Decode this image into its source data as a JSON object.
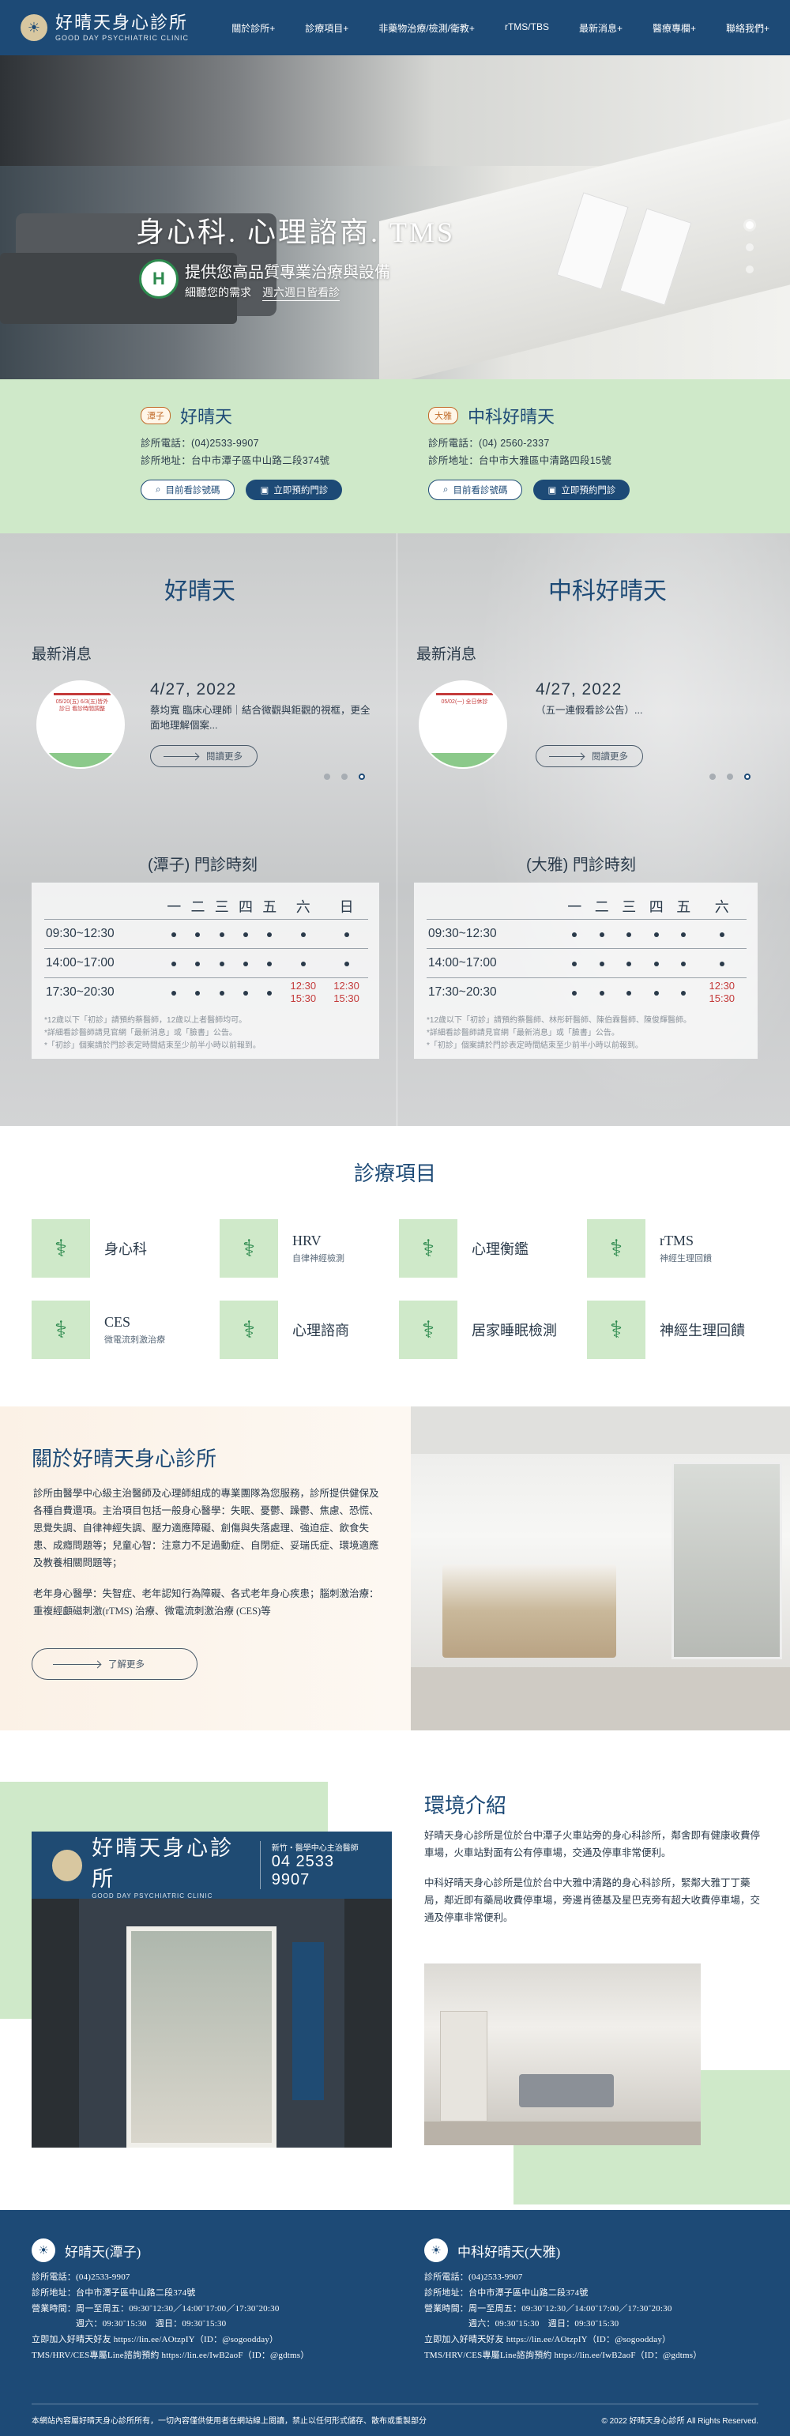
{
  "header": {
    "logo_title": "好晴天身心診所",
    "logo_sub": "GOOD DAY PSYCHIATRIC CLINIC",
    "nav": [
      "關於診所+",
      "診療項目+",
      "非藥物治療/檢測/衛教+",
      "rTMS/TBS",
      "最新消息+",
      "醫療專欄+",
      "聯絡我們+"
    ]
  },
  "hero": {
    "title": "身心科. 心理諮商. TMS",
    "badge": "H",
    "subtitle": "提供您高品質專業治療與設備",
    "sub2_a": "細聽您的需求",
    "sub2_b": "週六週日皆看診"
  },
  "branches": [
    {
      "tag": "潭子",
      "name": "好晴天",
      "phone": "診所電話：(04)2533-9907",
      "address": "診所地址：台中市潭子區中山路二段374號",
      "btn1": "目前看診號碼",
      "btn2": "立即預約門診"
    },
    {
      "tag": "大雅",
      "name": "中科好晴天",
      "phone": "診所電話：(04) 2560-2337",
      "address": "診所地址：台中市大雅區中清路四段15號",
      "btn1": "目前看診號碼",
      "btn2": "立即預約門診"
    }
  ],
  "news": [
    {
      "col_title": "好晴天",
      "heading": "最新消息",
      "poster": "05/20(五) 6/3(五)皆外診日 看診時間調整",
      "date": "4/27, 2022",
      "text": "蔡均寬 臨床心理師｜結合微觀與鉅觀的視框，更全面地理解個案...",
      "more": "閱讀更多"
    },
    {
      "col_title": "中科好晴天",
      "heading": "最新消息",
      "poster": "05/02(一) 全日休診",
      "date": "4/27, 2022",
      "text": "（五一連假看診公告）...",
      "more": "閱讀更多"
    }
  ],
  "hours": [
    {
      "title": "(潭子) 門診時刻",
      "days": [
        "一",
        "二",
        "三",
        "四",
        "五",
        "六",
        "日"
      ],
      "rows": [
        {
          "label": "09:30~12:30",
          "cells": [
            "•",
            "•",
            "•",
            "•",
            "•",
            "•",
            "•"
          ]
        },
        {
          "label": "14:00~17:00",
          "cells": [
            "•",
            "•",
            "•",
            "•",
            "•",
            "•",
            "•"
          ]
        },
        {
          "label": "17:30~20:30",
          "cells": [
            "•",
            "•",
            "•",
            "•",
            "•",
            "12:30 15:30",
            "12:30 15:30"
          ]
        }
      ],
      "notes": [
        "*12歲以下「初診」請預約蔡醫師，12歲以上者醫師均可。",
        "*詳細看診醫師請見官網「最新消息」或「臉書」公告。",
        "*「初診」個案請於門診表定時間結束至少前半小時以前報到。"
      ]
    },
    {
      "title": "(大雅) 門診時刻",
      "days": [
        "一",
        "二",
        "三",
        "四",
        "五",
        "六"
      ],
      "rows": [
        {
          "label": "09:30~12:30",
          "cells": [
            "•",
            "•",
            "•",
            "•",
            "•",
            "•"
          ]
        },
        {
          "label": "14:00~17:00",
          "cells": [
            "•",
            "•",
            "•",
            "•",
            "•",
            "•"
          ]
        },
        {
          "label": "17:30~20:30",
          "cells": [
            "•",
            "•",
            "•",
            "•",
            "•",
            "12:30 15:30"
          ]
        }
      ],
      "notes": [
        "*12歲以下「初診」請預約蔡醫師、林彤軒醫師、陳伯霖醫師、陳俊輝醫師。",
        "*詳細看診醫師請見官網「最新消息」或「臉書」公告。",
        "*「初診」個案請於門診表定時間結束至少前半小時以前報到。"
      ]
    }
  ],
  "services": {
    "title": "診療項目",
    "items": [
      {
        "name": "身心科",
        "sub": ""
      },
      {
        "name": "HRV",
        "sub": "自律神經檢測"
      },
      {
        "name": "心理衡鑑",
        "sub": ""
      },
      {
        "name": "rTMS",
        "sub": "神經生理回饋"
      },
      {
        "name": "CES",
        "sub": "微電流刺激治療"
      },
      {
        "name": "心理諮商",
        "sub": ""
      },
      {
        "name": "居家睡眠檢測",
        "sub": ""
      },
      {
        "name": "神經生理回饋",
        "sub": ""
      }
    ]
  },
  "about": {
    "title": "關於好晴天身心診所",
    "text": "診所由醫學中心級主治醫師及心理師組成的專業團隊為您服務，診所提供健保及各種自費還項。主治項目包括一般身心醫學：失眠、憂鬱、躁鬱、焦慮、恐慌、思覺失調、自律神經失調、壓力適應障礙、創傷與失落處理、強迫症、飲食失患、成癮問題等；兒童心智：注意力不足過動症、自閉症、妥瑞氏症、環境適應及教養相關問題等；",
    "text2": "老年身心醫學：失智症、老年認知行為障礙、各式老年身心疾患；腦刺激治療：重複經顱磁刺激(rTMS) 治療、微電流刺激治療 (CES)等",
    "more": "了解更多"
  },
  "env": {
    "title": "環境介紹",
    "p1": "好晴天身心診所是位於台中潭子火車站旁的身心科診所，鄰舍即有健康收費停車場，火車站對面有公有停車場，交通及停車非常便利。",
    "p2": "中科好晴天身心診所是位於台中大雅中清路的身心科診所，緊鄰大雅丁丁藥局，鄰近即有藥局收費停車場，旁邊肖德基及星巴克旁有超大收費停車場，交通及停車非常便利。",
    "sign_title": "好晴天身心診所",
    "sign_sub": "GOOD DAY PSYCHIATRIC CLINIC",
    "sign_rt1": "新竹・醫學中心主治醫師",
    "sign_rt2": "04 2533 9907"
  },
  "footer": {
    "cols": [
      {
        "name": "好晴天(潭子)",
        "lines": [
          "診所電話：(04)2533-9907",
          "診所地址：台中市潭子區中山路二段374號",
          "營業時間：周一至周五：09:30˜12:30／14:00˜17:00／17:30˜20:30",
          "　　　　　週六：09:30˜15:30　週日：09:30˜15:30",
          "立即加入好晴天好友 https://lin.ee/AOtzpIY（ID：@sogoodday）",
          "TMS/HRV/CES專屬Line諮詢預約 https://lin.ee/IwB2aoF（ID：@gdtms）"
        ]
      },
      {
        "name": "中科好晴天(大雅)",
        "lines": [
          "診所電話：(04)2533-9907",
          "診所地址：台中市潭子區中山路二段374號",
          "營業時間：周一至周五：09:30˜12:30／14:00˜17:00／17:30˜20:30",
          "　　　　　週六：09:30˜15:30　週日：09:30˜15:30",
          "立即加入好晴天好友 https://lin.ee/AOtzpIY（ID：@sogoodday）",
          "TMS/HRV/CES專屬Line諮詢預約 https://lin.ee/IwB2aoF（ID：@gdtms）"
        ]
      }
    ],
    "disclaimer": "本網站內容屬好晴天身心診所所有，一切內容僅供使用者在網站線上閱讀，禁止以任何形式儲存、散布或重製部分",
    "copyright": "© 2022 好晴天身心診所 All Rights Reserved."
  }
}
